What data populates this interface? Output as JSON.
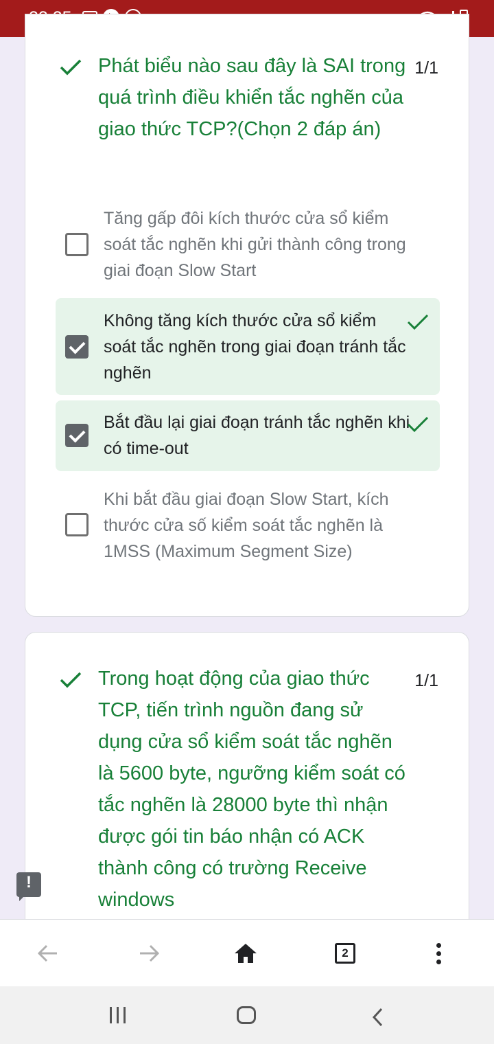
{
  "status_bar": {
    "time": "22:25",
    "notification_badge": "29",
    "icons": [
      "gallery-icon",
      "youtube-icon",
      "notification-count-icon",
      "dot-icon",
      "wifi-icon",
      "signal-icon",
      "battery-charging-icon"
    ]
  },
  "questions": [
    {
      "title": "Phát biểu nào sau đây là SAI trong quá trình điều khiển tắc nghẽn của giao thức TCP?(Chọn 2 đáp án)",
      "score": "1/1",
      "status": "correct",
      "options": [
        {
          "label": "Tăng gấp đôi kích thước cửa sổ kiểm soát tắc nghẽn khi gửi thành công trong giai đoạn Slow Start",
          "checked": false,
          "correct": false
        },
        {
          "label": "Không tăng kích thước cửa sổ kiểm soát tắc nghẽn trong giai đoạn tránh tắc nghẽn",
          "checked": true,
          "correct": true
        },
        {
          "label": "Bắt đầu lại giai đoạn tránh tắc nghẽn khi có time-out",
          "checked": true,
          "correct": true
        },
        {
          "label": "Khi bắt đầu giai đoạn Slow Start, kích thước cửa số kiểm soát tắc nghẽn là 1MSS (Maximum Segment Size)",
          "checked": false,
          "correct": false
        }
      ]
    },
    {
      "title": "Trong hoạt động của giao thức TCP, tiến trình nguồn đang sử dụng cửa sổ kiểm soát tắc nghẽn là 5600 byte, ngưỡng kiểm soát có tắc nghẽn là 28000 byte thì nhận được gói tin báo nhận có ACK thành công có trường Receive windows",
      "score": "1/1",
      "status": "correct"
    }
  ],
  "browser_toolbar": {
    "tab_count": "2",
    "buttons": [
      "back-arrow-icon",
      "forward-arrow-icon",
      "home-icon",
      "tab-switcher",
      "more-menu-icon"
    ]
  },
  "colors": {
    "status_bar": "#a31b1b",
    "correct_green": "#188038",
    "correct_bg": "#e6f4ea",
    "page_bg": "#efebf7"
  }
}
